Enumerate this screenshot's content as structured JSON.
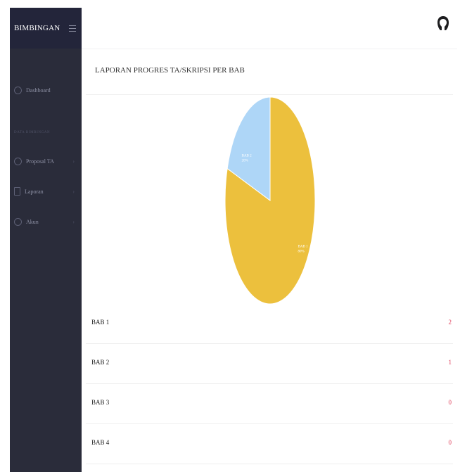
{
  "sidebar": {
    "brand": "BIMBINGAN",
    "items": [
      {
        "label": "Dashboard"
      },
      {
        "label": "Proposal TA",
        "chevron": "›"
      },
      {
        "label": "Laporan",
        "chevron": "›"
      },
      {
        "label": "Akun",
        "chevron": "›"
      }
    ],
    "section_label": "DATA BIMBINGAN"
  },
  "header": {
    "avatar_icon": "user-avatar-icon"
  },
  "main": {
    "card_title": "LAPORAN PROGRES TA/SKRIPSI PER BAB",
    "rows": [
      {
        "label": "BAB 1",
        "count": "2"
      },
      {
        "label": "BAB 2",
        "count": "1"
      },
      {
        "label": "BAB 3",
        "count": "0"
      },
      {
        "label": "BAB 4",
        "count": "0"
      }
    ]
  },
  "chart_data": {
    "type": "pie",
    "slices": [
      {
        "label": "BAB 1",
        "percent": 80,
        "value_label": "80%",
        "color": "#ecc03d"
      },
      {
        "label": "BAB 2",
        "percent": 20,
        "value_label": "20%",
        "color": "#aed6f7"
      }
    ]
  },
  "colors": {
    "sidebar_bg": "#2a2c3a",
    "sidebar_header_bg": "#23253a",
    "count_color": "#e0405c"
  }
}
